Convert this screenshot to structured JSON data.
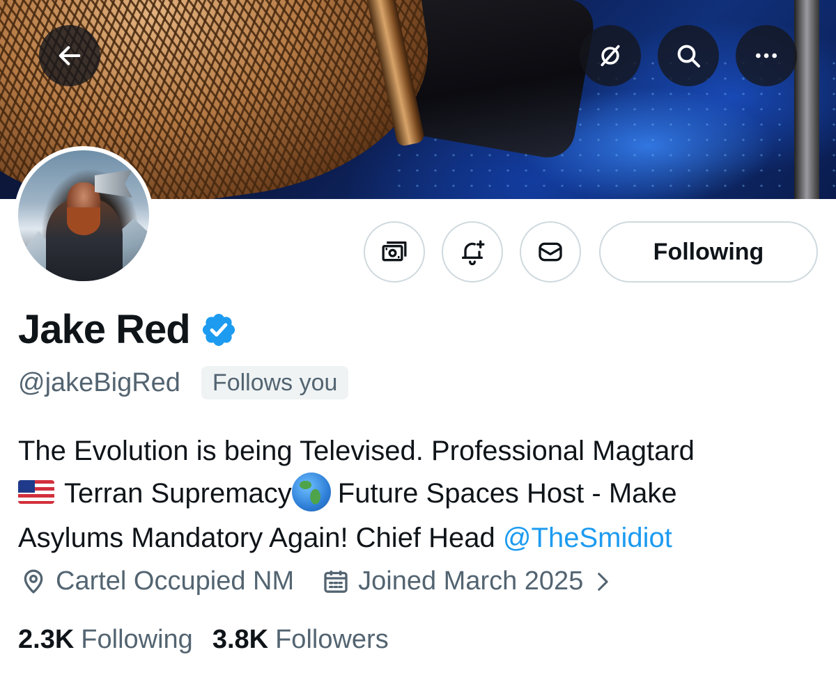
{
  "profile": {
    "display_name": "Jake Red",
    "handle": "@jakeBigRed",
    "follows_you_badge": "Follows you",
    "bio_line1": "The Evolution is being Televised. Professional Magtard",
    "bio_line2_a": "Terran Supremacy",
    "bio_line2_b": "Future Spaces Host - Make",
    "bio_line3": "Asylums Mandatory Again! Chief Head ",
    "bio_mention": "@TheSmidiot",
    "location": "Cartel Occupied NM",
    "joined": "Joined March 2025",
    "following_count": "2.3K",
    "following_label": "Following",
    "followers_count": "3.8K",
    "followers_label": "Followers"
  },
  "actions": {
    "following_button_label": "Following"
  },
  "icons": {
    "back": "arrow-left-icon",
    "grok": "grok-icon",
    "search": "search-icon",
    "more": "more-icon",
    "subscribe": "money-icon",
    "notify": "bell-plus-icon",
    "message": "envelope-icon",
    "verified": "verified-badge-icon",
    "location": "location-pin-icon",
    "calendar": "calendar-icon",
    "chevron": "chevron-right-icon",
    "flag": "us-flag-emoji",
    "globe": "globe-americas-emoji"
  },
  "colors": {
    "text_primary": "#0f1419",
    "text_secondary": "#536471",
    "link": "#1d9bf0",
    "border": "#cfd9de",
    "verified": "#1d9bf0"
  }
}
